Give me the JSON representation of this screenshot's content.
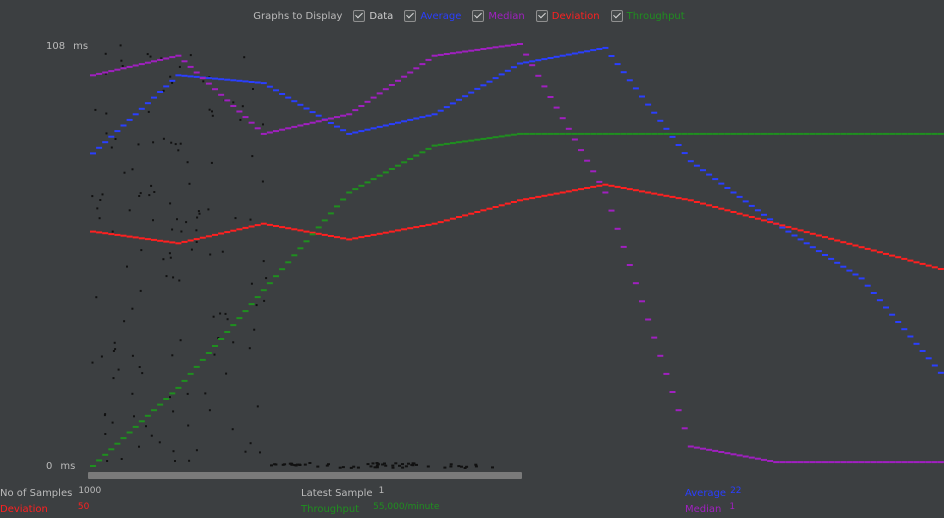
{
  "toolbar": {
    "title": "Graphs to Display",
    "options": [
      {
        "label": "Data",
        "checked": true,
        "color": "#d0d0d0"
      },
      {
        "label": "Average",
        "checked": true,
        "color": "#2a3fff"
      },
      {
        "label": "Median",
        "checked": true,
        "color": "#a020c0"
      },
      {
        "label": "Deviation",
        "checked": true,
        "color": "#ff2020"
      },
      {
        "label": "Throughput",
        "checked": true,
        "color": "#1f8f1f"
      }
    ]
  },
  "axis": {
    "y_max": "108",
    "y_min": "0",
    "unit": "ms"
  },
  "stats": {
    "samples_label": "No of Samples",
    "samples_value": "1000",
    "deviation_label": "Deviation",
    "deviation_value": "50",
    "latest_label": "Latest Sample",
    "latest_value": "1",
    "throughput_label": "Throughput",
    "throughput_value": "55,000/minute",
    "average_label": "Average",
    "average_value": "22",
    "median_label": "Median",
    "median_value": "1"
  },
  "chart_data": {
    "type": "line",
    "ylim": [
      0,
      108
    ],
    "yunit": "ms",
    "x": [
      0,
      10,
      20,
      30,
      40,
      50,
      60,
      70,
      80,
      90,
      100
    ],
    "series": [
      {
        "name": "Average",
        "color": "#2a3fff",
        "values": [
          80,
          100,
          98,
          85,
          90,
          103,
          107,
          78,
          62,
          48,
          22
        ]
      },
      {
        "name": "Median",
        "color": "#a020c0",
        "values": [
          100,
          105,
          85,
          90,
          105,
          108,
          70,
          5,
          1,
          1,
          1
        ]
      },
      {
        "name": "Deviation",
        "color": "#ff2020",
        "values": [
          60,
          57,
          62,
          58,
          62,
          68,
          72,
          68,
          62,
          56,
          50
        ]
      },
      {
        "name": "Throughput",
        "color": "#1f8f1f",
        "values": [
          0,
          20,
          45,
          70,
          82,
          85,
          85,
          85,
          85,
          85,
          85
        ]
      }
    ]
  }
}
